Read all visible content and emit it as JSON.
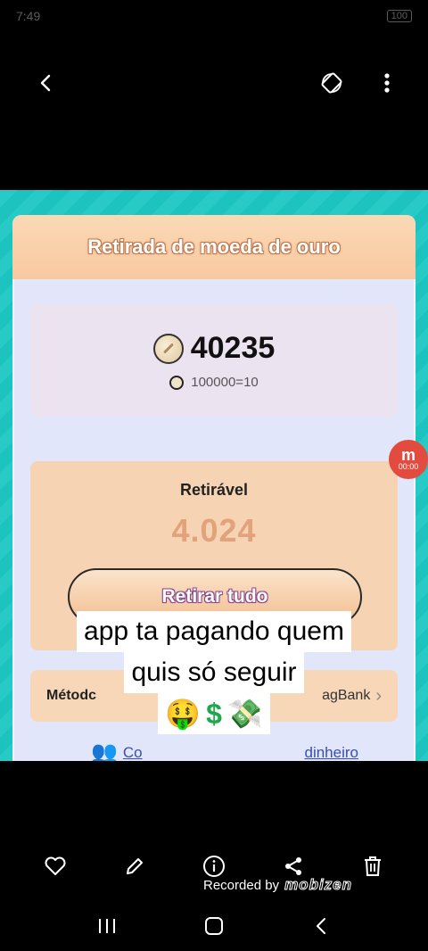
{
  "status_bar": {
    "time": "7:49",
    "battery": "100"
  },
  "panel": {
    "title": "Retirada de moeda de ouro",
    "balance": "40235",
    "rate": "100000=10",
    "withdrawable_label": "Retirável",
    "withdrawable_amount": "4.024",
    "withdraw_button": "Retirar tudo",
    "method_label": "Métodc",
    "method_value": "agBank",
    "help_text_start": "Co",
    "help_text_end": "dinheiro"
  },
  "recorder_badge": {
    "logo": "m",
    "time": "00:00"
  },
  "caption": {
    "line1": "app ta pagando quem",
    "line2": "quis só seguir",
    "emoji_money_face": "🤑",
    "emoji_dollar": "$",
    "emoji_money_wings": "💸"
  },
  "recorded_by": {
    "label": "Recorded by",
    "brand": "mobizen"
  },
  "icons": {
    "back": "chevron-left-icon",
    "rotate": "rotate-icon",
    "more": "more-vertical-icon",
    "like": "heart-icon",
    "edit": "pencil-icon",
    "info": "info-icon",
    "share": "share-icon",
    "delete": "trash-icon"
  }
}
